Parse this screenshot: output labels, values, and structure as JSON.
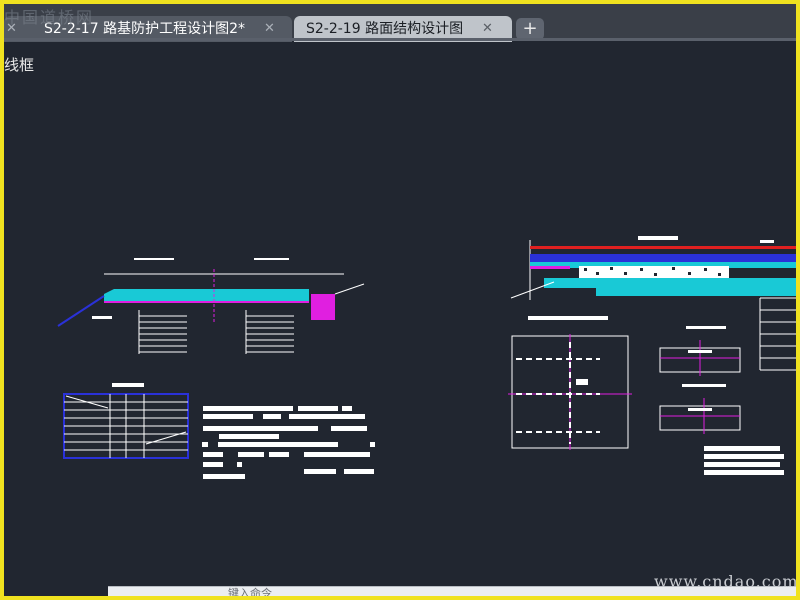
{
  "watermark_top": "中国道桥网",
  "tabs": [
    {
      "label": "S2-2-17 路基防护工程设计图2*",
      "close": "✕",
      "active": false
    },
    {
      "label": "S2-2-19 路面结构设计图",
      "close": "✕",
      "active": true
    }
  ],
  "add_tab_label": "+",
  "canvas_fragment_text": "线框",
  "status_text": "键入命令",
  "watermark_bottom": "www.cndao.com",
  "colors": {
    "frame": "#f0e21f",
    "canvas": "#212630",
    "cyan": "#19c9d6",
    "magenta": "#e01fe0",
    "blue": "#2a31d8",
    "red": "#e02020",
    "white": "#ffffff"
  }
}
